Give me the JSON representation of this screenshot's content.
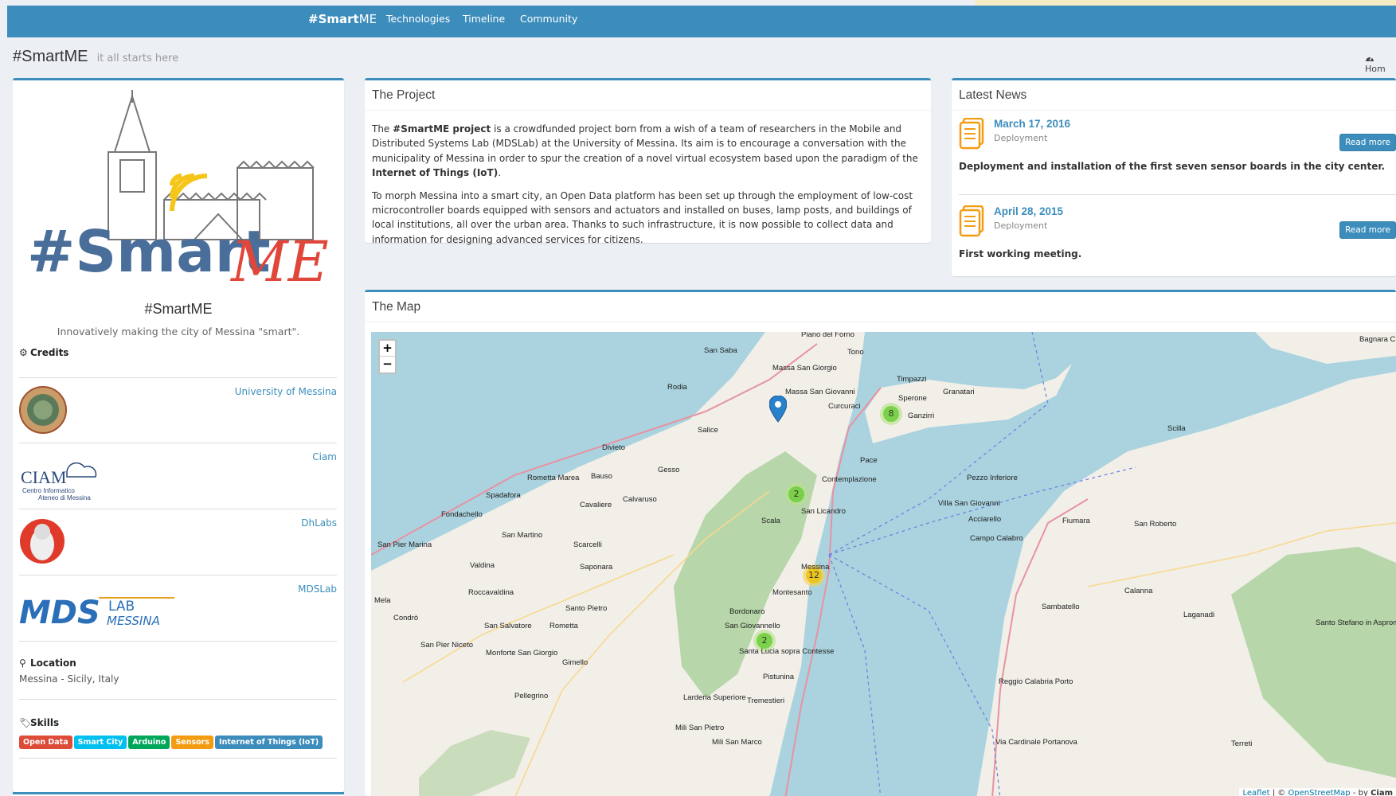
{
  "navbar": {
    "brand_bold": "#Smart",
    "brand_rest": "ME",
    "items": [
      "Technologies",
      "Timeline",
      "Community"
    ]
  },
  "header": {
    "title": "#SmartME",
    "subtitle": "it all starts here",
    "breadcrumb": "Hom"
  },
  "profile": {
    "name": "#SmartME",
    "description": "Innovatively making the city of Messina \"smart\".",
    "logo_text_a": "#Smart",
    "logo_text_b": "ME"
  },
  "credits": {
    "title": "Credits",
    "items": [
      {
        "name": "University of Messina"
      },
      {
        "name": "Ciam",
        "logo_text_1": "CIAM",
        "logo_text_2": "Centro Informatico",
        "logo_text_3": "Ateneo di Messina"
      },
      {
        "name": "DhLabs"
      },
      {
        "name": "MDSLab",
        "logo_text_1": "MDS",
        "logo_text_2": "LAB",
        "logo_text_3": "MESSINA"
      }
    ]
  },
  "location": {
    "title": "Location",
    "value": "Messina - Sicily, Italy"
  },
  "skills": {
    "title": "Skills",
    "labels": [
      {
        "text": "Open Data",
        "color": "#dd4b39"
      },
      {
        "text": "Smart City",
        "color": "#00c0ef"
      },
      {
        "text": "Arduino",
        "color": "#00a65a"
      },
      {
        "text": "Sensors",
        "color": "#f39c12"
      },
      {
        "text": "Internet of Things (IoT)",
        "color": "#3c8dbc"
      }
    ]
  },
  "project": {
    "title": "The Project",
    "p1_a": "The ",
    "p1_b": "#SmartME project",
    "p1_c": " is a crowdfunded project born from a wish of a team of researchers in the Mobile and Distributed Systems Lab (MDSLab) at the University of Messina. Its aim is to encourage a conversation with the municipality of Messina in order to spur the creation of a novel virtual ecosystem based upon the paradigm of the ",
    "p1_d": "Internet of Things (IoT)",
    "p1_e": ".",
    "p2": "To morph Messina into a smart city, an Open Data platform has been set up through the employment of low-cost microcontroller boards equipped with sensors and actuators and installed on buses, lamp posts, and buildings of local institutions, all over the urban area. Thanks to such infrastructure, it is now possible to collect data and information for designing advanced services for citizens."
  },
  "news": {
    "title": "Latest News",
    "items": [
      {
        "date": "March 17, 2016",
        "category": "Deployment",
        "button": "Read more",
        "text": "Deployment and installation of the first seven sensor boards in the city center."
      },
      {
        "date": "April 28, 2015",
        "category": "Deployment",
        "button": "Read more",
        "text": "First working meeting."
      }
    ]
  },
  "map": {
    "title": "The Map",
    "zoom_in": "+",
    "zoom_out": "−",
    "attribution_a": "Leaflet",
    "attribution_b": " | © ",
    "attribution_c": "OpenStreetMap",
    "attribution_d": " - by ",
    "attribution_e": "Ciam",
    "clusters": [
      {
        "count": "8",
        "color": "green"
      },
      {
        "count": "2",
        "color": "green"
      },
      {
        "count": "12",
        "color": "yellow"
      },
      {
        "count": "2",
        "color": "green"
      }
    ],
    "places": [
      "Piano del Forno",
      "San Saba",
      "Tono",
      "Massa San Giorgio",
      "Rodia",
      "Massa San Giovanni",
      "Timpazzi",
      "Sperone",
      "Granatari",
      "Curcuraci",
      "Ganzirri",
      "Salice",
      "Divieto",
      "Gesso",
      "Pace",
      "Bauso",
      "Rometta Marea",
      "Spadafora",
      "Contemplazione",
      "Calvaruso",
      "Cavaliere",
      "Pezzo Inferiore",
      "Villa San Giovanni",
      "Acciarello",
      "Scala",
      "San Licandro",
      "Fondachello",
      "San Martino",
      "Scarcelli",
      "San Pier Marina",
      "Valdina",
      "Saponara",
      "Messina",
      "Roccavaldina",
      "Montesanto",
      "Santo Pietro",
      "Bordonaro",
      "Rometta",
      "San Salvatore",
      "Condrò",
      "San Giovannello",
      "San Pier Niceto",
      "Monforte San Giorgio",
      "Gimello",
      "Santa Lucia sopra Contesse",
      "Pistunina",
      "Pellegrino",
      "Larderia Superiore",
      "Tremestieri",
      "Mili San Pietro",
      "Mili San Marco",
      "Fiumara",
      "San Roberto",
      "Calanna",
      "Sambatello",
      "Laganadi",
      "Santo Stefano in Aspromonte",
      "Scilla",
      "Terreti",
      "Bagnara C",
      "Mela",
      "Campo Calabro",
      "Reggio Calabria Porto",
      "Via Cardinale Portanova"
    ]
  },
  "colors": {
    "primary": "#3c8dbc",
    "background": "#ecf0f5",
    "sea": "#aad3df",
    "land": "#f2efe9",
    "forest": "#add19e"
  }
}
